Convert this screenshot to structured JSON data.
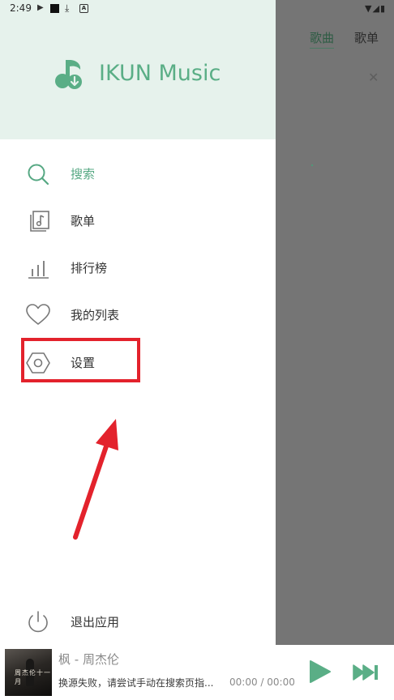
{
  "status_bar": {
    "time": "2:49",
    "icons": [
      "play-icon",
      "square-icon",
      "download-icon",
      "a-box-icon"
    ],
    "right_icons": [
      "wifi-icon",
      "signal-icon",
      "battery-icon"
    ]
  },
  "background_app": {
    "tabs": [
      {
        "label": "歌曲",
        "active": true
      },
      {
        "label": "歌单",
        "active": false
      }
    ],
    "close_icon": "close-icon"
  },
  "drawer": {
    "app_name": "IKUN Music",
    "logo_icon": "music-note-download-icon",
    "items": [
      {
        "label": "搜索",
        "icon": "search-icon",
        "active": true
      },
      {
        "label": "歌单",
        "icon": "playlist-icon",
        "active": false
      },
      {
        "label": "排行榜",
        "icon": "chart-bars-icon",
        "active": false
      },
      {
        "label": "我的列表",
        "icon": "heart-icon",
        "active": false
      },
      {
        "label": "设置",
        "icon": "settings-hexagon-icon",
        "active": false
      }
    ],
    "exit_label": "退出应用",
    "exit_icon": "power-icon"
  },
  "player": {
    "title": "枫 - 周杰伦",
    "status": "换源失败，请尝试手动在搜索页指...",
    "time": "00:00 / 00:00",
    "album_cover_text": "周杰伦十一月",
    "play_icon": "play-icon",
    "next_icon": "skip-next-icon"
  },
  "colors": {
    "accent": "#5aae86",
    "header_bg": "#e6f2ec",
    "highlight": "#e3222c",
    "scrim": "#757575"
  }
}
